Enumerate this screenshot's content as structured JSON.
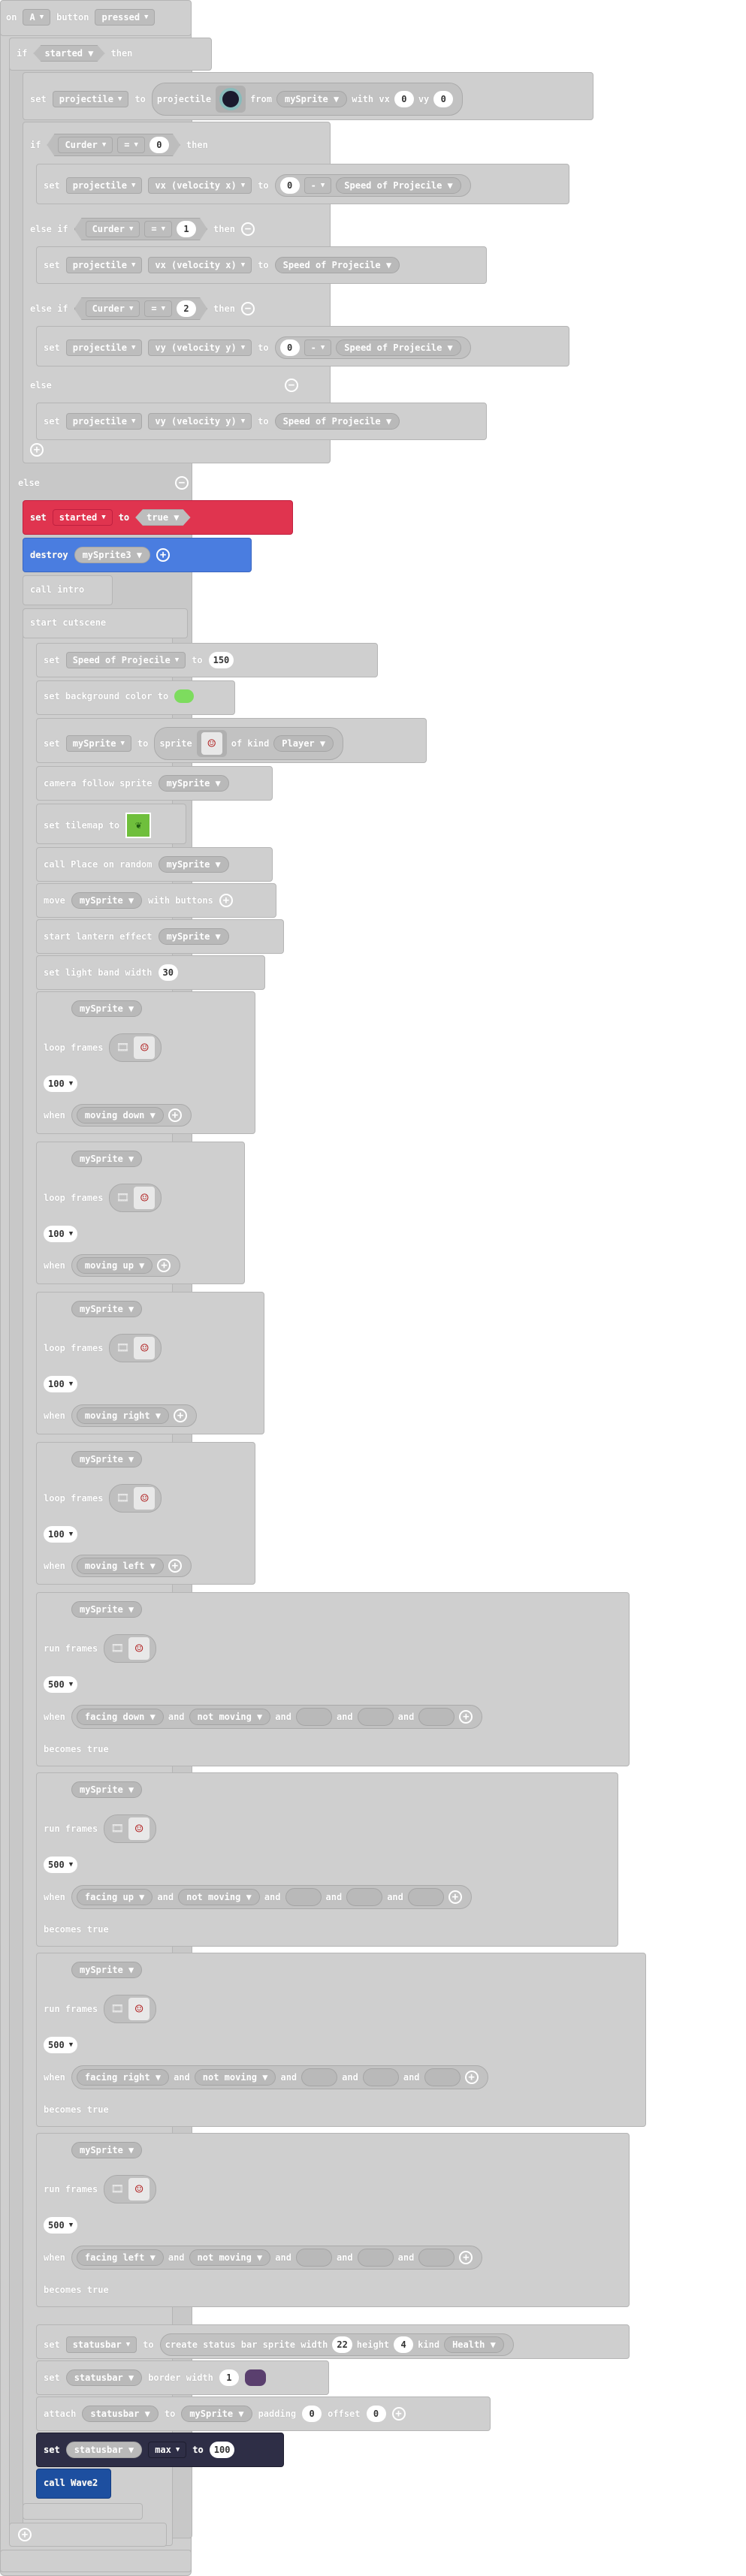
{
  "header": {
    "on": "on",
    "key": "A",
    "button": "button",
    "event": "pressed"
  },
  "if_started": {
    "if": "if",
    "cond": "started",
    "then": "then"
  },
  "set_projectile": {
    "set": "set",
    "var": "projectile",
    "to": "to",
    "projectile_from": "projectile",
    "from": "from",
    "sprite": "mySprite",
    "with_vx": "with vx",
    "vx": "0",
    "vy_label": "vy",
    "vy": "0"
  },
  "if_curder0": {
    "if": "if",
    "var": "Curder",
    "op": "=",
    "val": "0",
    "then": "then"
  },
  "set_vx_neg": {
    "set": "set",
    "var": "projectile",
    "prop": "vx (velocity x)",
    "to": "to",
    "a": "0",
    "op": "-",
    "b": "Speed of Projecile"
  },
  "elseif1": {
    "label": "else if",
    "var": "Curder",
    "op": "=",
    "val": "1",
    "then": "then"
  },
  "set_vx_pos": {
    "set": "set",
    "var": "projectile",
    "prop": "vx (velocity x)",
    "to": "to",
    "b": "Speed of Projecile"
  },
  "elseif2": {
    "label": "else if",
    "var": "Curder",
    "op": "=",
    "val": "2",
    "then": "then"
  },
  "set_vy_neg": {
    "set": "set",
    "var": "projectile",
    "prop": "vy (velocity y)",
    "to": "to",
    "a": "0",
    "op": "-",
    "b": "Speed of Projecile"
  },
  "else_inner": {
    "label": "else"
  },
  "set_vy_pos": {
    "set": "set",
    "var": "projectile",
    "prop": "vy (velocity y)",
    "to": "to",
    "b": "Speed of Projecile"
  },
  "else_outer": {
    "label": "else"
  },
  "set_started": {
    "set": "set",
    "var": "started",
    "to": "to",
    "val": "true"
  },
  "destroy": {
    "label": "destroy",
    "sprite": "mySprite3"
  },
  "call_intro": {
    "label": "call intro"
  },
  "start_cutscene": {
    "label": "start cutscene"
  },
  "set_speed": {
    "set": "set",
    "var": "Speed of Projecile",
    "to": "to",
    "val": "150"
  },
  "bg_color": {
    "label": "set background color to"
  },
  "set_mysprite": {
    "set": "set",
    "var": "mySprite",
    "to": "to",
    "sprite": "sprite",
    "of_kind": "of kind",
    "kind": "Player"
  },
  "camera": {
    "label": "camera follow sprite",
    "sprite": "mySprite"
  },
  "tilemap": {
    "label": "set tilemap to"
  },
  "place": {
    "label": "call Place on random",
    "sprite": "mySprite"
  },
  "move": {
    "label": "move",
    "sprite": "mySprite",
    "with": "with buttons"
  },
  "lantern": {
    "label": "start lantern effect",
    "sprite": "mySprite"
  },
  "band": {
    "label": "set light band width",
    "val": "30"
  },
  "loops": [
    {
      "sprite": "mySprite",
      "loop": "loop frames",
      "interval": "100",
      "when": "when",
      "state": "moving down"
    },
    {
      "sprite": "mySprite",
      "loop": "loop frames",
      "interval": "100",
      "when": "when",
      "state": "moving up"
    },
    {
      "sprite": "mySprite",
      "loop": "loop frames",
      "interval": "100",
      "when": "when",
      "state": "moving right"
    },
    {
      "sprite": "mySprite",
      "loop": "loop frames",
      "interval": "100",
      "when": "when",
      "state": "moving left"
    }
  ],
  "runs": [
    {
      "sprite": "mySprite",
      "run": "run frames",
      "interval": "500",
      "when": "when",
      "state": "facing down",
      "and": "and",
      "state2": "not moving",
      "becomes": "becomes true"
    },
    {
      "sprite": "mySprite",
      "run": "run frames",
      "interval": "500",
      "when": "when",
      "state": "facing up",
      "and": "and",
      "state2": "not moving",
      "becomes": "becomes true"
    },
    {
      "sprite": "mySprite",
      "run": "run frames",
      "interval": "500",
      "when": "when",
      "state": "facing right",
      "and": "and",
      "state2": "not moving",
      "becomes": "becomes true"
    },
    {
      "sprite": "mySprite",
      "run": "run frames",
      "interval": "500",
      "when": "when",
      "state": "facing left",
      "and": "and",
      "state2": "not moving",
      "becomes": "becomes true"
    }
  ],
  "statusbar_create": {
    "set": "set",
    "var": "statusbar",
    "to": "to",
    "create": "create status bar sprite width",
    "width": "22",
    "height_label": "height",
    "height": "4",
    "kind_label": "kind",
    "kind": "Health"
  },
  "statusbar_border": {
    "set": "set",
    "var": "statusbar",
    "label": "border width",
    "val": "1"
  },
  "statusbar_attach": {
    "label": "attach",
    "var": "statusbar",
    "to": "to",
    "sprite": "mySprite",
    "padding": "padding",
    "pad": "0",
    "offset": "offset",
    "off": "0"
  },
  "statusbar_max": {
    "set": "set",
    "var": "statusbar",
    "prop": "max",
    "to": "to",
    "val": "100"
  },
  "call_wave": {
    "label": "call Wave2"
  },
  "icons": {
    "caret": "▼",
    "plus": "+",
    "minus": "−",
    "film": "🎞",
    "sprite": "☺",
    "leaf": "❦"
  }
}
